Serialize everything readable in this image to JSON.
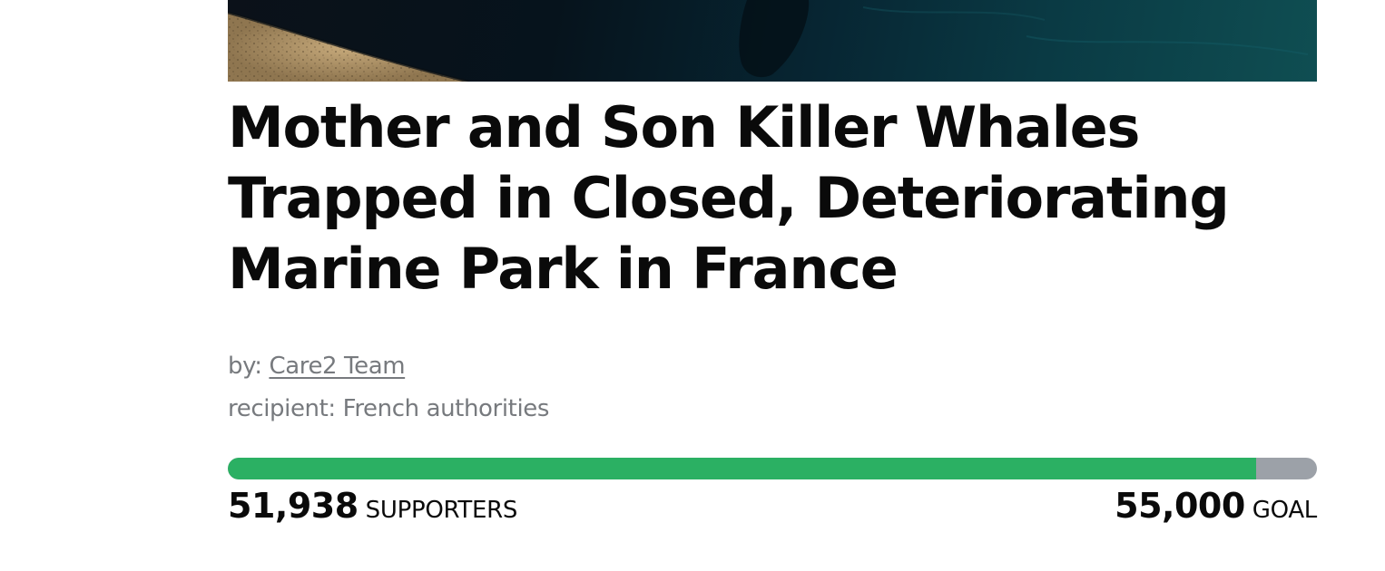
{
  "petition": {
    "title": "Mother and Son Killer Whales Trapped in Closed, Deteriorating Marine Park in France",
    "by_label": "by:",
    "author": "Care2 Team",
    "recipient_label": "recipient:",
    "recipient": "French authorities"
  },
  "progress": {
    "supporters": "51,938",
    "supporters_label": "SUPPORTERS",
    "goal": "55,000",
    "goal_label": "GOAL",
    "fraction": 0.944
  },
  "colors": {
    "progress_fill": "#2bb063",
    "progress_track": "#9ca1a8",
    "meta_text": "#777a7e",
    "title_text": "#0a0a0a"
  }
}
